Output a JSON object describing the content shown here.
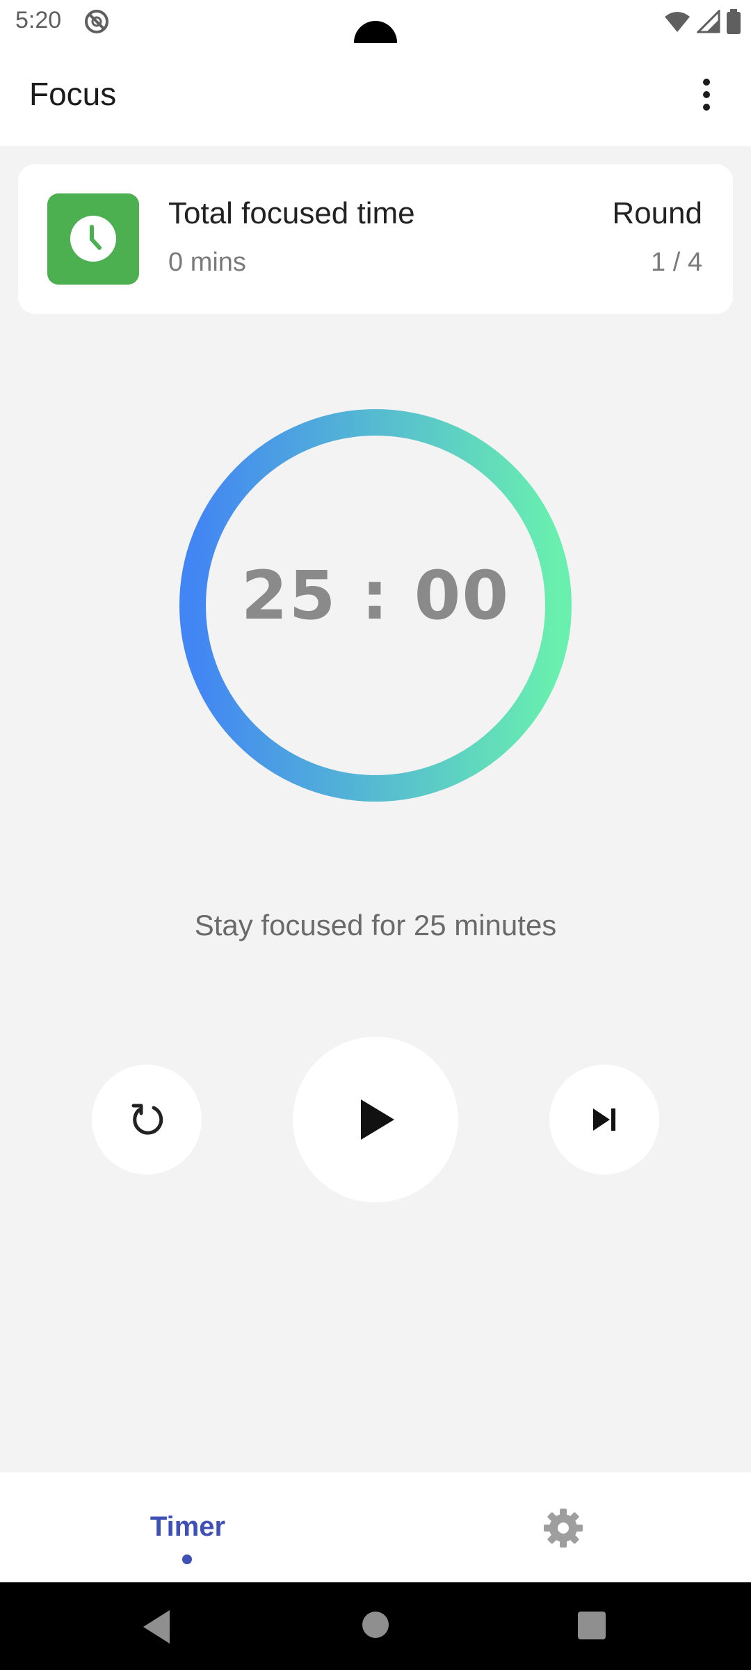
{
  "status_bar": {
    "time": "5:20",
    "icons": [
      "dnd-icon",
      "wifi-icon",
      "signal-icon",
      "battery-icon"
    ]
  },
  "app_bar": {
    "title": "Focus",
    "menu_icon": "more-vert-icon"
  },
  "summary_card": {
    "icon": "clock-icon",
    "icon_color": "#4caf50",
    "title": "Total focused time",
    "value": "0 mins",
    "round_label": "Round",
    "round_value": "1 / 4"
  },
  "timer": {
    "display": "25 : 00",
    "ring_gradient": [
      "#4285f4",
      "#69f0ae"
    ],
    "hint": "Stay focused for 25 minutes"
  },
  "controls": {
    "reset_icon": "reset-icon",
    "play_icon": "play-icon",
    "skip_icon": "skip-next-icon"
  },
  "bottom_nav": {
    "items": [
      {
        "label": "Timer",
        "active": true
      },
      {
        "icon": "settings-icon",
        "active": false
      }
    ],
    "active_color": "#3f51b5"
  },
  "system_nav": {
    "icons": [
      "back-icon",
      "home-icon",
      "recents-icon"
    ]
  }
}
